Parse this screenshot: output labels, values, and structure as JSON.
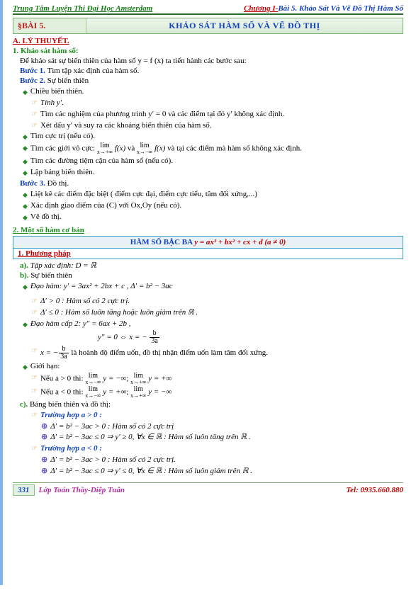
{
  "header": {
    "left": "Trung Tâm Luyện Thi Đại Học Amsterdam",
    "right_red": "Chương I-",
    "right_blue": "Bài 5. Khảo Sát Và Vẽ Đồ Thị Hàm Số"
  },
  "lesson": {
    "tag": "§BÀI 5.",
    "title": "KHẢO SÁT HÀM SỐ VÀ VẼ ĐỒ THỊ"
  },
  "A": {
    "heading": "A. LÝ THUYẾT.",
    "s1_title": "1. Khảo sát hàm số:",
    "intro": "Để khảo sát sự biến thiên của hàm số y = f (x) ta tiến hành các bước sau:",
    "b1": "Bước 1.",
    "b1_text": " Tìm tập xác định của hàm số.",
    "b2": "Bước 2.",
    "b2_text": " Sự biến thiên",
    "items2": [
      "Chiều biến thiên.",
      "Tính y′.",
      "Tìm các nghiệm của phương trình y′ = 0 và các điểm tại đó y′ không xác định.",
      "Xét dấu y′ và suy ra các khoảng biến thiên của hàm số.",
      "Tìm cực trị (nếu có).",
      "Tìm các giới vô cực: ",
      " và tại các điểm mà hàm số không xác định.",
      "Tìm các đường tiệm cận của hàm số (nếu có).",
      "Lập bảng biến thiên."
    ],
    "b3": "Bước 3.",
    "b3_text": " Đồ thị.",
    "items3": [
      "Liệt kê các điểm đặc biệt ( điểm cực đại, điểm cực tiểu, tâm đối xứng,...)",
      "Xác định giao điểm của (C) với Ox,Oy (nếu có).",
      "Vẽ đồ thị."
    ]
  },
  "B": {
    "title": "2. Một số hàm cơ bản",
    "box_label": "HÀM SỐ BẬC BA ",
    "box_expr": "y = ax³ + bx² + cx + d    (a ≠ 0)",
    "pp": "1.  Phương pháp",
    "a_label": "a).",
    "a_text": " Tập xác định: D = ℝ",
    "b_label": "b).",
    "b_text": " Sự biến thiên",
    "der": "Đạo hàm: y′ = 3ax² + 2bx + c ,  Δ′ = b² − 3ac",
    "d1": "Δ′ > 0 : Hàm số có 2 cực trị.",
    "d2": "Δ′ ≤ 0 : Hàm số luôn tăng hoặc luôn giảm trên ℝ .",
    "der2": "Đạo hàm cấp 2: y″ = 6ax + 2b ,",
    "der2_eq": "y″ = 0 ⇔ x = −",
    "frac_num": "b",
    "frac_den": "3a",
    "uon": " là hoành độ điểm uốn, đồ thị nhận điểm uốn làm tâm đối xứng.",
    "gh": "Giới hạn:",
    "gh1a": "Nếu a > 0 thì: ",
    "gh1b": "Nếu a < 0 thì: ",
    "c_label": "c).",
    "c_text": " Bảng biến thiên và đồ thị:",
    "th_a_pos": "Trường hợp a > 0 :",
    "th_a_neg": "Trường hợp a < 0 :",
    "cases_pos": [
      "Δ′ = b² − 3ac > 0 : Hàm số có 2 cực trị",
      "Δ′ = b² − 3ac ≤ 0 ⇒ y′ ≥ 0, ∀x ∈ ℝ : Hàm số luôn tăng trên ℝ ."
    ],
    "cases_neg": [
      "Δ′ = b² − 3ac > 0 : Hàm số có 2 cực trị.",
      "Δ′ = b² − 3ac ≤ 0 ⇒ y′ ≤ 0, ∀x ∈ ℝ : Hàm số luôn giảm trên ℝ ."
    ]
  },
  "footer": {
    "page": "331",
    "mid": "Lớp Toán Thầy-Diệp Tuân",
    "tel": "Tel: 0935.660.880"
  }
}
